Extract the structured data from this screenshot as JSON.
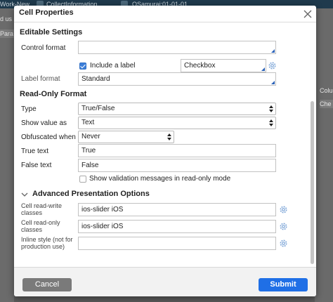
{
  "background": {
    "breadcrumbs": [
      "Work-New",
      "CollectInformation",
      "OSamurai:01-01-01"
    ],
    "left_texts": [
      "d us",
      "Para"
    ],
    "right_texts": [
      "Colu",
      "Che"
    ]
  },
  "dialog": {
    "title": "Cell Properties",
    "editable": {
      "heading": "Editable Settings",
      "control_format_label": "Control format",
      "control_format_value": "",
      "include_label_text": "Include a label",
      "include_label_checked": true,
      "label_value": "Checkbox",
      "label_format_label": "Label format",
      "label_format_value": "Standard"
    },
    "readonly": {
      "heading": "Read-Only Format",
      "type_label": "Type",
      "type_value": "True/False",
      "show_value_label": "Show value as",
      "show_value_value": "Text",
      "obfuscated_label": "Obfuscated when",
      "obfuscated_value": "Never",
      "true_text_label": "True text",
      "true_text_value": "True",
      "false_text_label": "False text",
      "false_text_value": "False",
      "show_validation_text": "Show validation messages in read-only mode",
      "show_validation_checked": false
    },
    "advanced": {
      "heading": "Advanced Presentation Options",
      "rw_classes_label": "Cell read-write classes",
      "rw_classes_value": "ios-slider iOS",
      "ro_classes_label": "Cell read-only classes",
      "ro_classes_value": "ios-slider iOS",
      "inline_style_label": "Inline style (not for production use)",
      "inline_style_value": ""
    },
    "buttons": {
      "cancel": "Cancel",
      "submit": "Submit"
    }
  },
  "colors": {
    "primary": "#1f6fe6",
    "cancel": "#7a7a7a",
    "checkbox_checked": "#3d7fd9",
    "gear": "#7ea6d8"
  }
}
